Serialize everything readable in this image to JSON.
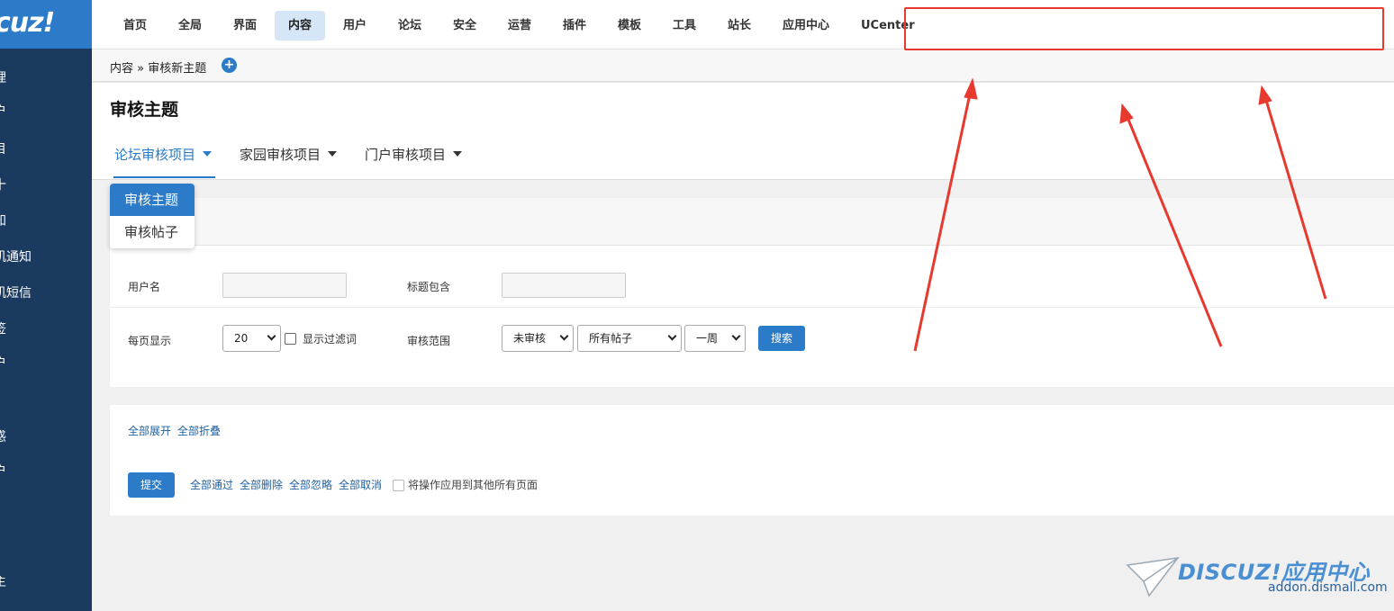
{
  "logo": {
    "text": "cuz!"
  },
  "sidebar": {
    "items": [
      {
        "label": "理"
      },
      {
        "label": "户"
      },
      {
        "label": "目"
      },
      {
        "label": "十"
      },
      {
        "label": "知"
      },
      {
        "label": "机通知"
      },
      {
        "label": "机短信"
      },
      {
        "label": "签"
      },
      {
        "label": "户"
      },
      {
        "label": "惑"
      },
      {
        "label": "户"
      },
      {
        "label": "主"
      }
    ]
  },
  "topnav": {
    "items": [
      {
        "label": "首页"
      },
      {
        "label": "全局"
      },
      {
        "label": "界面"
      },
      {
        "label": "内容"
      },
      {
        "label": "用户"
      },
      {
        "label": "论坛"
      },
      {
        "label": "安全"
      },
      {
        "label": "运营"
      },
      {
        "label": "插件"
      },
      {
        "label": "模板"
      },
      {
        "label": "工具"
      },
      {
        "label": "站长"
      },
      {
        "label": "应用中心"
      },
      {
        "label": "UCenter"
      }
    ],
    "active": "内容"
  },
  "breadcrumb": {
    "text": "内容 » 审核新主题",
    "add_icon": "+"
  },
  "page": {
    "title": "审核主题"
  },
  "tabs": [
    {
      "label": "论坛审核项目"
    },
    {
      "label": "家园审核项目"
    },
    {
      "label": "门户审核项目"
    }
  ],
  "dropdown": {
    "items": [
      {
        "label": "审核主题"
      },
      {
        "label": "审核帖子"
      }
    ]
  },
  "filter": {
    "username_label": "用户名",
    "username_value": "",
    "title_label": "标题包含",
    "title_value": "",
    "perpage_label": "每页显示",
    "perpage_value": "20",
    "show_filter_label": "显示过滤词",
    "scope_label": "审核范围",
    "status_value": "未审核",
    "posts_value": "所有帖子",
    "period_value": "一周",
    "search_button": "搜索"
  },
  "actions": {
    "expand_all": "全部展开",
    "collapse_all": "全部折叠",
    "submit_button": "提交",
    "approve_all": "全部通过",
    "delete_all": "全部删除",
    "ignore_all": "全部忽略",
    "cancel_all": "全部取消",
    "apply_all_label": "将操作应用到其他所有页面"
  },
  "watermark": {
    "brand": "DISCUZ!应用中心",
    "domain": "addon.dismall.com"
  },
  "colors": {
    "sidebar": "#1a3a60",
    "accent": "#2b7bc9",
    "annotation": "#e8392f"
  }
}
